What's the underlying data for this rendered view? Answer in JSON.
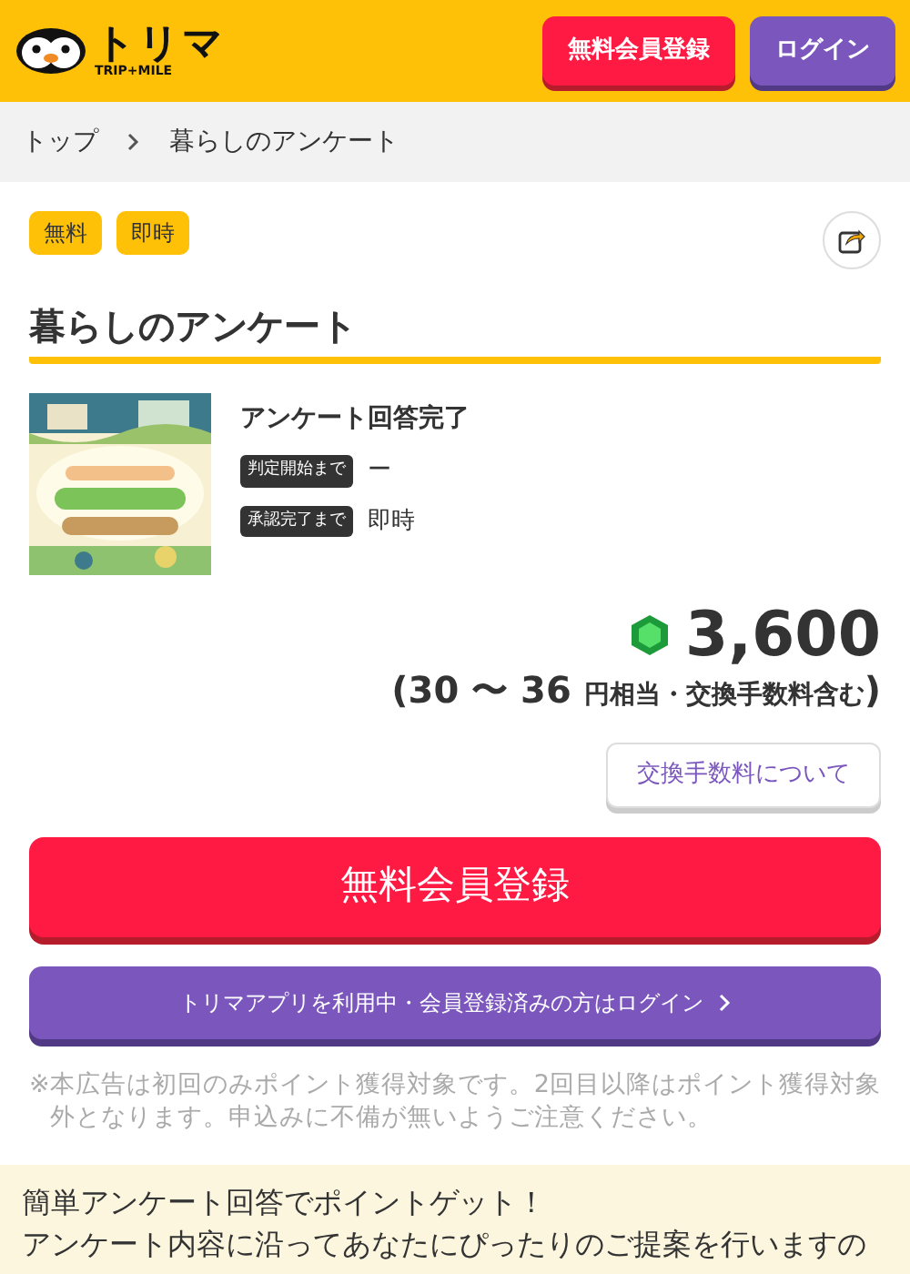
{
  "header": {
    "logo_title": "トリマ",
    "logo_subtitle": "TRIP+MILE",
    "buttons": [
      {
        "label": "無料会員登録",
        "kind": "register"
      },
      {
        "label": "ログイン",
        "kind": "login"
      }
    ]
  },
  "breadcrumb": [
    {
      "label": "トップ"
    },
    {
      "label": "暮らしのアンケート"
    }
  ],
  "tags": [
    "無料",
    "即時"
  ],
  "title": "暮らしのアンケート",
  "offer": {
    "condition": "アンケート回答完了",
    "rows": [
      {
        "label": "判定開始まで",
        "value": "ー"
      },
      {
        "label": "承認完了まで",
        "value": "即時"
      }
    ]
  },
  "points": {
    "value": "3,600",
    "yen_open": "(",
    "yen_range": "30 〜 36",
    "yen_note": "円相当・交換手数料含む",
    "yen_close": ")"
  },
  "fee_button": "交換手数料について",
  "register_button": "無料会員登録",
  "login_button": "トリマアプリを利用中・会員登録済みの方はログイン",
  "notice_mark": "※",
  "notice": "本広告は初回のみポイント獲得対象です。2回目以降はポイント獲得対象外となります。申込みに不備が無いようご注意ください。",
  "description": [
    "簡単アンケート回答でポイントゲット！",
    "アンケート内容に沿ってあなたにぴったりのご提案を行いますの"
  ]
}
